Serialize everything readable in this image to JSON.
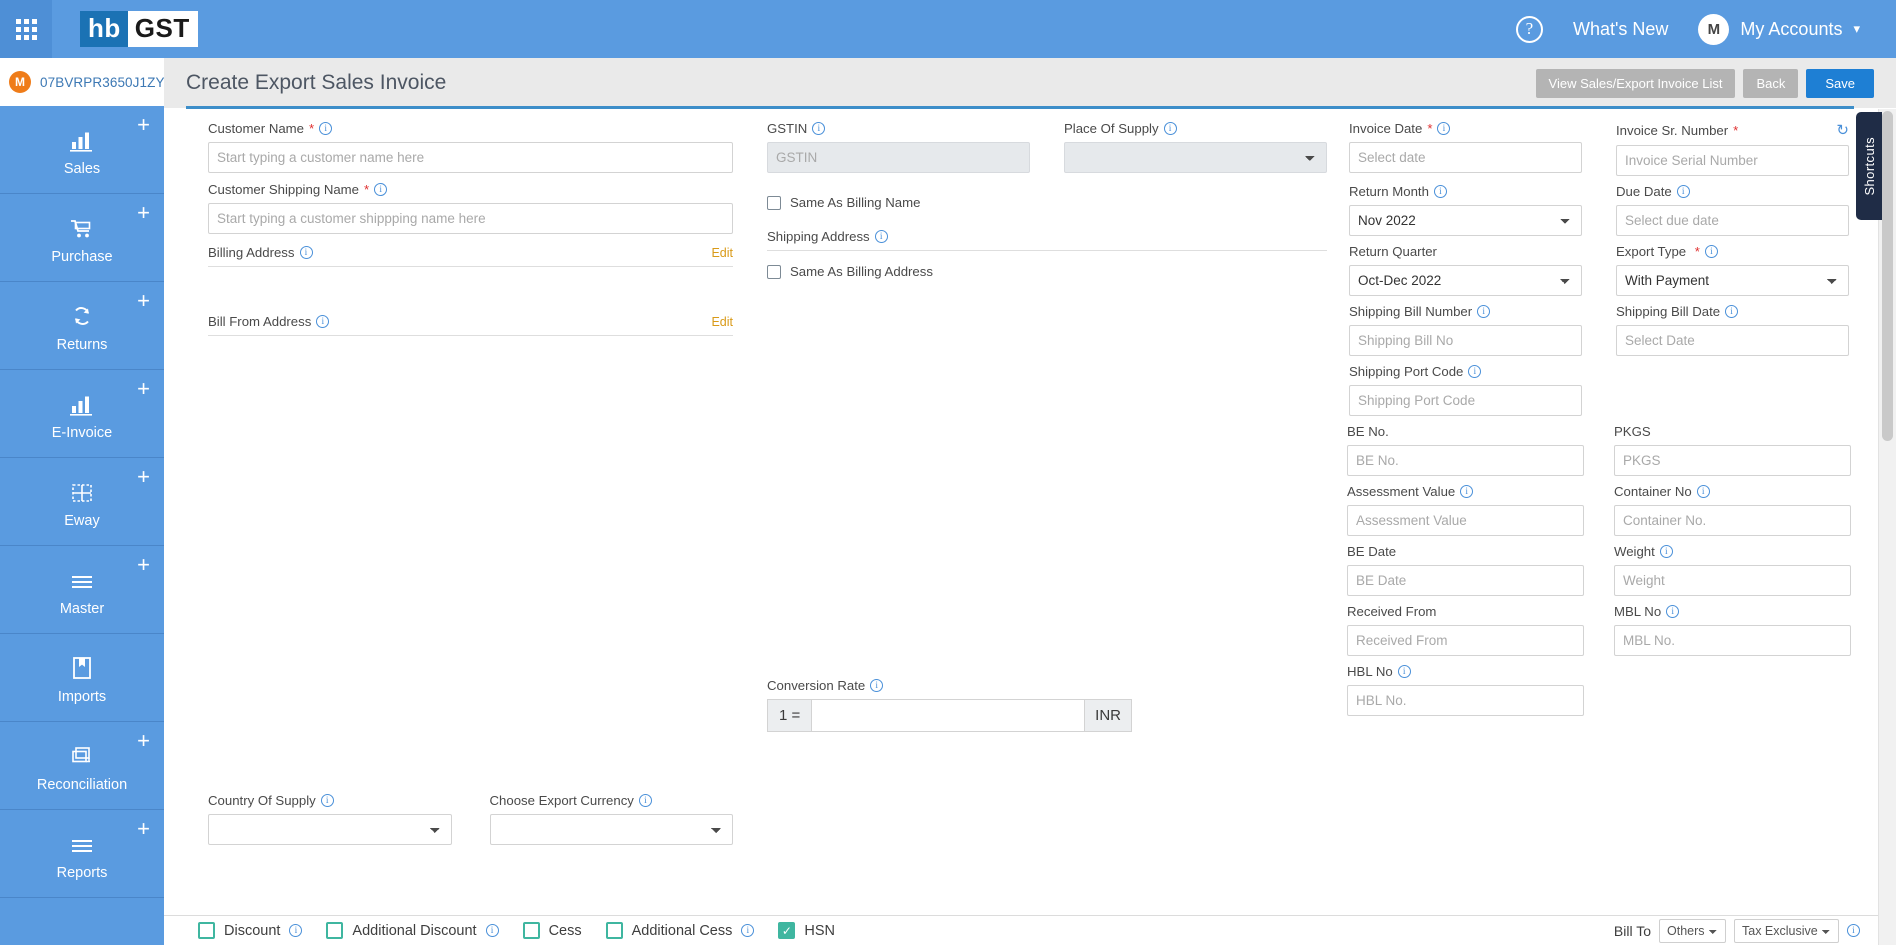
{
  "app": {
    "logo_primary": "hb",
    "logo_secondary": "GST",
    "accent_blue": "#5a9be0",
    "accent_dark_blue": "#1b72b4",
    "save_blue": "#1e7fd4",
    "edit_orange": "#d99a18",
    "check_teal": "#3fb6a0"
  },
  "topbar": {
    "apps_icon": "apps-grid-icon",
    "help_icon": "help-question-icon",
    "help_label": "?",
    "whats_new": "What's New",
    "account_initial": "M",
    "account_label": "My Accounts",
    "chevron": "⌄"
  },
  "sidebar": {
    "gstin_initial": "M",
    "gstin": "07BVRPR3650J1ZY",
    "items": [
      {
        "label": "Sales",
        "icon": "bar-chart-icon",
        "has_add": true
      },
      {
        "label": "Purchase",
        "icon": "cart-icon",
        "has_add": true
      },
      {
        "label": "Returns",
        "icon": "refresh-cycle-icon",
        "has_add": true
      },
      {
        "label": "E-Invoice",
        "icon": "bar-chart-icon",
        "has_add": true
      },
      {
        "label": "Eway",
        "icon": "grid-dashed-icon",
        "has_add": true
      },
      {
        "label": "Master",
        "icon": "hamburger-icon",
        "has_add": true
      },
      {
        "label": "Imports",
        "icon": "bookmark-book-icon",
        "has_add": false
      },
      {
        "label": "Reconciliation",
        "icon": "layers-copy-icon",
        "has_add": true
      },
      {
        "label": "Reports",
        "icon": "hamburger-icon",
        "has_add": true
      }
    ],
    "add_glyph": "+"
  },
  "page": {
    "title": "Create Export Sales Invoice",
    "buttons": {
      "view_list": "View Sales/Export Invoice List",
      "back": "Back",
      "save": "Save"
    }
  },
  "shortcuts_tab": "Shortcuts",
  "form": {
    "customer_name": {
      "label": "Customer Name",
      "required": true,
      "placeholder": "Start typing a customer name here",
      "value": ""
    },
    "customer_shipping_name": {
      "label": "Customer Shipping Name",
      "required": true,
      "placeholder": "Start typing a customer shippping name here",
      "value": ""
    },
    "billing_address": {
      "label": "Billing Address",
      "edit": "Edit"
    },
    "bill_from_address": {
      "label": "Bill From Address",
      "edit": "Edit"
    },
    "gstin": {
      "label": "GSTIN",
      "placeholder": "GSTIN",
      "value": "",
      "disabled": true
    },
    "place_of_supply": {
      "label": "Place Of Supply",
      "value": "",
      "options": [
        ""
      ]
    },
    "same_as_billing_name": {
      "label": "Same As Billing Name",
      "checked": false
    },
    "shipping_address": {
      "label": "Shipping Address"
    },
    "same_as_billing_address": {
      "label": "Same As Billing Address",
      "checked": false
    },
    "invoice_date": {
      "label": "Invoice Date",
      "required": true,
      "placeholder": "Select date",
      "value": ""
    },
    "invoice_sr_number": {
      "label": "Invoice Sr. Number",
      "required": true,
      "placeholder": "Invoice Serial Number",
      "value": "",
      "refresh_icon": "refresh-icon"
    },
    "return_month": {
      "label": "Return Month",
      "value": "Nov 2022",
      "options": [
        "Nov 2022"
      ]
    },
    "due_date": {
      "label": "Due Date",
      "placeholder": "Select due date",
      "value": ""
    },
    "return_quarter": {
      "label": "Return Quarter",
      "value": "Oct-Dec 2022",
      "options": [
        "Oct-Dec 2022"
      ]
    },
    "export_type": {
      "label": "Export Type",
      "required": true,
      "value": "With Payment",
      "options": [
        "With Payment"
      ]
    },
    "shipping_bill_number": {
      "label": "Shipping Bill Number",
      "placeholder": "Shipping Bill No",
      "value": ""
    },
    "shipping_bill_date": {
      "label": "Shipping Bill Date",
      "placeholder": "Select Date",
      "value": ""
    },
    "shipping_port_code": {
      "label": "Shipping Port Code",
      "placeholder": "Shipping Port Code",
      "value": ""
    },
    "be_no": {
      "label": "BE No.",
      "placeholder": "BE No.",
      "value": ""
    },
    "pkgs": {
      "label": "PKGS",
      "placeholder": "PKGS",
      "value": ""
    },
    "assessment_value": {
      "label": "Assessment Value",
      "placeholder": "Assessment Value",
      "value": ""
    },
    "container_no": {
      "label": "Container No",
      "placeholder": "Container No.",
      "value": ""
    },
    "be_date": {
      "label": "BE Date",
      "placeholder": "BE Date",
      "value": ""
    },
    "weight": {
      "label": "Weight",
      "placeholder": "Weight",
      "value": ""
    },
    "received_from": {
      "label": "Received From",
      "placeholder": "Received From",
      "value": ""
    },
    "mbl_no": {
      "label": "MBL No",
      "placeholder": "MBL No.",
      "value": ""
    },
    "hbl_no": {
      "label": "HBL No",
      "placeholder": "HBL No.",
      "value": ""
    },
    "country_of_supply": {
      "label": "Country Of Supply",
      "value": "",
      "options": [
        ""
      ]
    },
    "export_currency": {
      "label": "Choose Export Currency",
      "value": "",
      "options": [
        ""
      ]
    },
    "conversion_rate": {
      "label": "Conversion Rate",
      "prefix": "1 =",
      "suffix": "INR",
      "value": ""
    }
  },
  "bottom": {
    "checkboxes": [
      {
        "label": "Discount",
        "checked": false,
        "info": true
      },
      {
        "label": "Additional Discount",
        "checked": false,
        "info": true
      },
      {
        "label": "Cess",
        "checked": false,
        "info": false
      },
      {
        "label": "Additional Cess",
        "checked": false,
        "info": true
      },
      {
        "label": "HSN",
        "checked": true,
        "info": false
      }
    ],
    "bill_to_label": "Bill To",
    "bill_to_value": "Others",
    "bill_to_options": [
      "Others"
    ],
    "tax_mode_value": "Tax Exclusive",
    "tax_mode_options": [
      "Tax Exclusive"
    ]
  }
}
